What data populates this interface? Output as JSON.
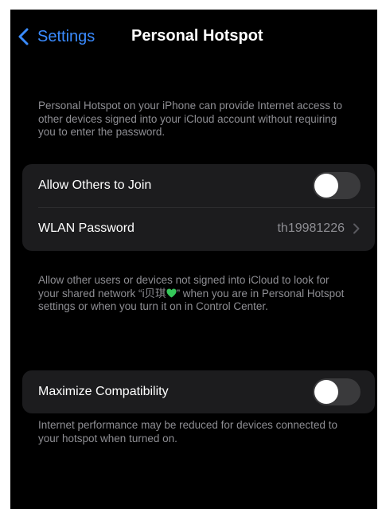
{
  "nav": {
    "back_label": "Settings",
    "title": "Personal Hotspot"
  },
  "intro_text": "Personal Hotspot on your iPhone can provide Internet access to other devices signed into your iCloud account without requiring you to enter the password.",
  "sharing_group": {
    "allow_others": {
      "label": "Allow Others to Join",
      "enabled": false
    },
    "wlan_password": {
      "label": "WLAN Password",
      "value": "th19981226"
    }
  },
  "sharing_footer": {
    "before_name": "Allow other users or devices not signed into iCloud to look for your shared network “",
    "network_name": "i贝琪",
    "after_name": "” when you are in Personal Hotspot settings or when you turn it on in Control Center."
  },
  "compat_group": {
    "maximize": {
      "label": "Maximize Compatibility",
      "enabled": false
    }
  },
  "compat_footer": "Internet performance may be reduced for devices connected to your hotspot when turned on.",
  "colors": {
    "accent": "#3a8bff",
    "background": "#000000",
    "cell": "#1c1c1e",
    "secondary_text": "#8e8e93",
    "toggle_off": "#3a3a3c",
    "heart": "#35c759"
  },
  "icons": {
    "back": "chevron-left-icon",
    "disclosure": "chevron-right-icon",
    "emoji": "green-heart-icon"
  }
}
